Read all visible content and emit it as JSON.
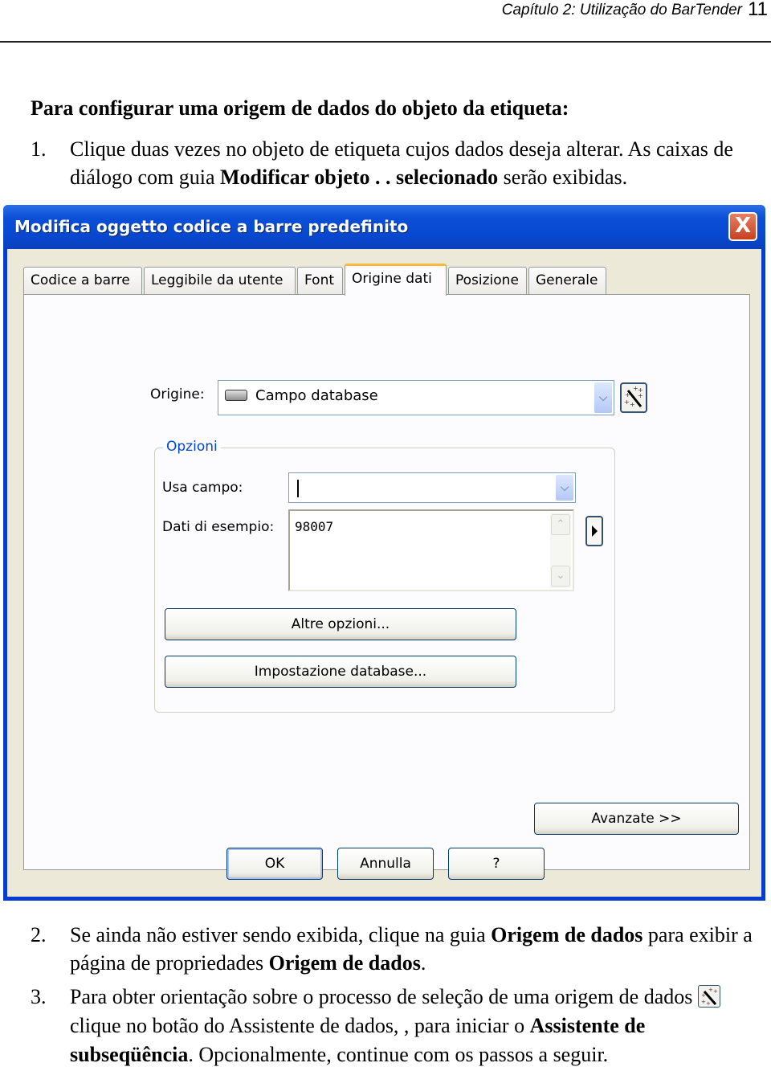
{
  "page_header": {
    "chapter_title": "Capítulo 2: Utilização do BarTender",
    "page_number": "11"
  },
  "section_heading": "Para configurar uma origem de dados do objeto da etiqueta:",
  "steps": [
    {
      "number": "1.",
      "parts": [
        {
          "text": "Clique duas vezes no objeto de etiqueta cujos dados deseja alterar. As caixas de diálogo com guia ",
          "bold": false
        },
        {
          "text": "Modificar objeto . . selecionado",
          "bold": true
        },
        {
          "text": " serão exibidas.",
          "bold": false
        }
      ]
    },
    {
      "number": "2.",
      "parts": [
        {
          "text": "Se ainda não estiver sendo exibida, clique na guia ",
          "bold": false
        },
        {
          "text": "Origem de dados",
          "bold": true
        },
        {
          "text": " para exibir a página de propriedades ",
          "bold": false
        },
        {
          "text": "Origem de dados",
          "bold": true
        },
        {
          "text": ".",
          "bold": false
        }
      ]
    },
    {
      "number": "3.",
      "parts": [
        {
          "text": "Para obter orientação sobre o processo de seleção de uma origem de dados ",
          "bold": false
        },
        {
          "icon": "magic-wand-icon"
        },
        {
          "text": "clique no botão do Assistente de dados, , para iniciar o ",
          "bold": false
        },
        {
          "text": "Assistente de subseqüência",
          "bold": true
        },
        {
          "text": ". Opcionalmente, continue com os passos a seguir.",
          "bold": false
        }
      ]
    }
  ],
  "dialog": {
    "title": "Modifica oggetto codice a barre predefinito",
    "close_label": "X",
    "tabs": [
      {
        "label": "Codice a barre",
        "active": false
      },
      {
        "label": "Leggibile da utente",
        "active": false
      },
      {
        "label": "Font",
        "active": false
      },
      {
        "label": "Origine dati",
        "active": true
      },
      {
        "label": "Posizione",
        "active": false
      },
      {
        "label": "Generale",
        "active": false
      }
    ],
    "source_label": "Origine:",
    "source_value": "Campo database",
    "options_group_label": "Opzioni",
    "use_field_label": "Usa campo:",
    "use_field_value": "",
    "sample_data_label": "Dati di esempio:",
    "sample_data_value": "98007",
    "more_options_button": "Altre opzioni...",
    "database_setup_button": "Impostazione database...",
    "advanced_button": "Avanzate >>",
    "ok_button": "OK",
    "cancel_button": "Annulla",
    "help_button": "?"
  }
}
